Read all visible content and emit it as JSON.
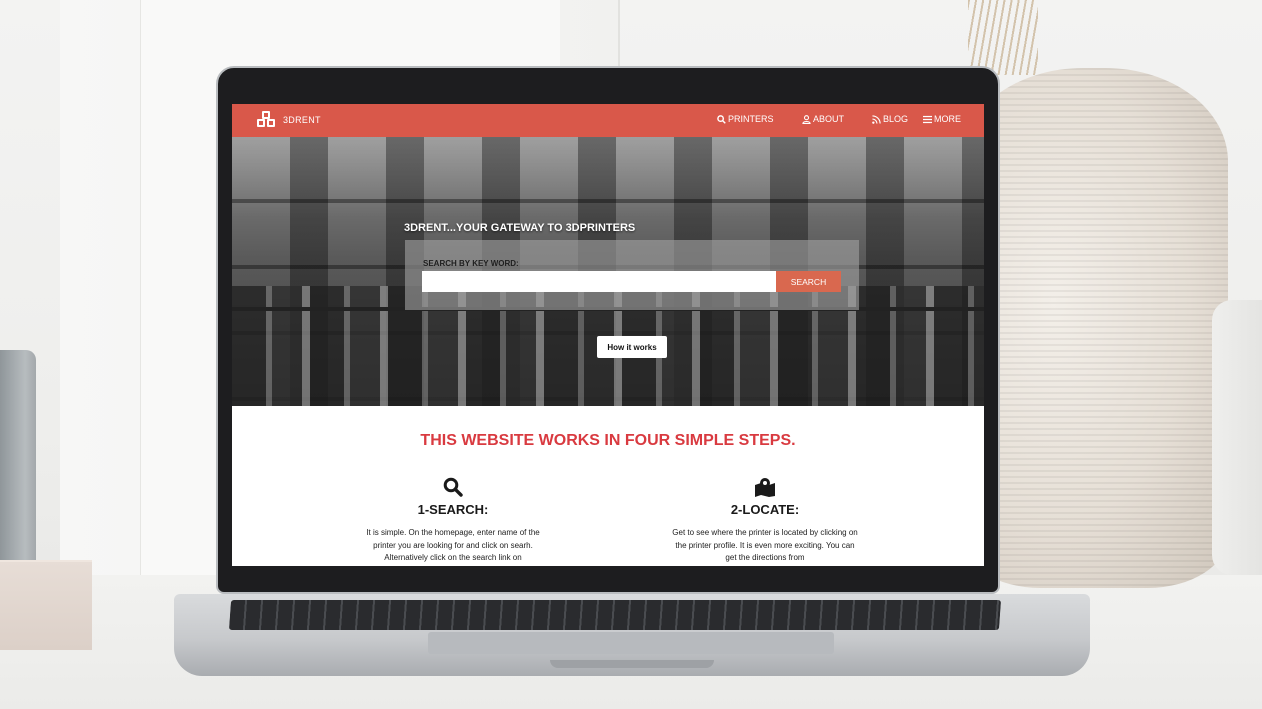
{
  "nav": {
    "brand": "3DRENT",
    "items": [
      {
        "label": "PRINTERS",
        "icon": "search-icon"
      },
      {
        "label": "ABOUT",
        "icon": "user-icon"
      },
      {
        "label": "BLOG",
        "icon": "rss-icon"
      },
      {
        "label": "MORE",
        "icon": "menu-icon"
      }
    ]
  },
  "hero": {
    "title": "3DRENT...YOUR GATEWAY TO 3DPRINTERS",
    "search_label": "SEARCH BY KEY WORD:",
    "search_placeholder": "",
    "search_button": "SEARCH",
    "how_button": "How it works"
  },
  "steps": {
    "heading": "THIS WEBSITE WORKS IN FOUR SIMPLE STEPS.",
    "items": [
      {
        "icon": "search-icon",
        "title": "1-SEARCH:",
        "text": "It is simple. On the homepage, enter name of the printer you are looking for and click on searh. Alternatively click on the search link on"
      },
      {
        "icon": "map-marker-icon",
        "title": "2-LOCATE:",
        "text": "Get to see where the printer is located by clicking on the printer profile. It is even more exciting. You can get the directions from"
      }
    ]
  },
  "colors": {
    "nav_bg": "#d9584a",
    "search_button": "#d9684f",
    "heading": "#d93a40"
  }
}
